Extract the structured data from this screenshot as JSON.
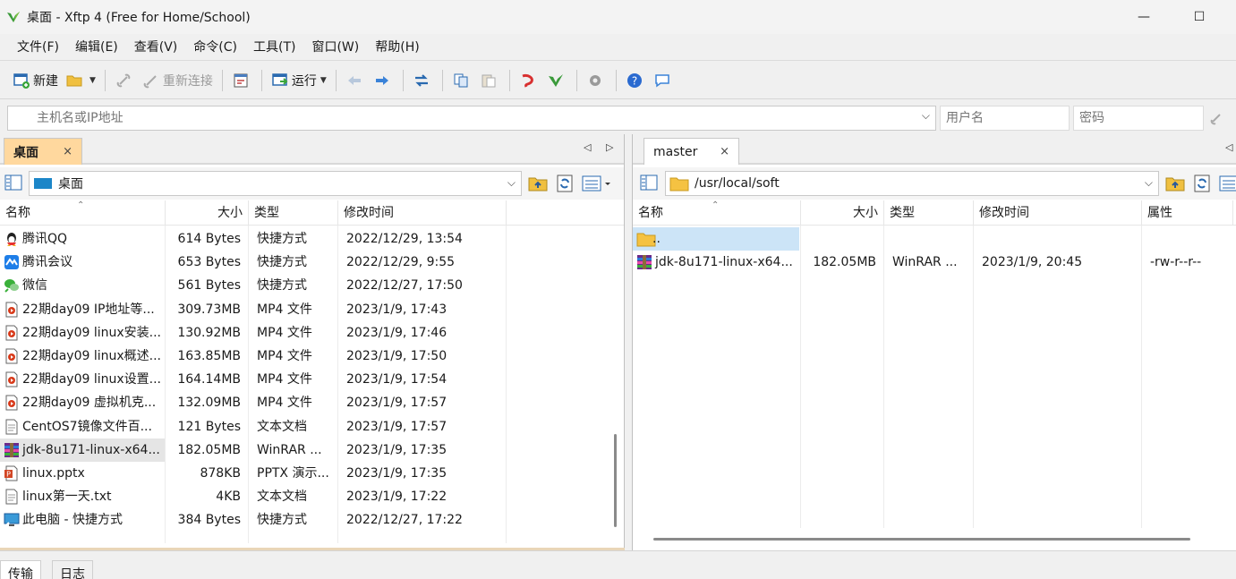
{
  "window": {
    "title": "桌面 - Xftp 4 (Free for Home/School)",
    "minimize": "—",
    "maximize": "☐",
    "close": "✕"
  },
  "menu": [
    "文件(F)",
    "编辑(E)",
    "查看(V)",
    "命令(C)",
    "工具(T)",
    "窗口(W)",
    "帮助(H)"
  ],
  "toolbar": {
    "new_label": "新建",
    "reconnect_label": "重新连接",
    "run_label": "运行"
  },
  "address": {
    "host_placeholder": "主机名或IP地址",
    "user_placeholder": "用户名",
    "pass_placeholder": "密码"
  },
  "left_panel": {
    "tab_label": "桌面",
    "tab_close": "×",
    "path": "桌面",
    "columns": [
      "名称",
      "大小",
      "类型",
      "修改时间"
    ],
    "files": [
      {
        "name": "腾讯QQ",
        "size": "614 Bytes",
        "type": "快捷方式",
        "modified": "2022/12/29, 13:54",
        "icon": "qq-icon"
      },
      {
        "name": "腾讯会议",
        "size": "653 Bytes",
        "type": "快捷方式",
        "modified": "2022/12/29, 9:55",
        "icon": "meeting-icon"
      },
      {
        "name": "微信",
        "size": "561 Bytes",
        "type": "快捷方式",
        "modified": "2022/12/27, 17:50",
        "icon": "wechat-icon"
      },
      {
        "name": "22期day09 IP地址等...",
        "size": "309.73MB",
        "type": "MP4 文件",
        "modified": "2023/1/9, 17:43",
        "icon": "video-file-icon"
      },
      {
        "name": "22期day09 linux安装...",
        "size": "130.92MB",
        "type": "MP4 文件",
        "modified": "2023/1/9, 17:46",
        "icon": "video-file-icon"
      },
      {
        "name": "22期day09 linux概述...",
        "size": "163.85MB",
        "type": "MP4 文件",
        "modified": "2023/1/9, 17:50",
        "icon": "video-file-icon"
      },
      {
        "name": "22期day09 linux设置...",
        "size": "164.14MB",
        "type": "MP4 文件",
        "modified": "2023/1/9, 17:54",
        "icon": "video-file-icon"
      },
      {
        "name": "22期day09 虚拟机克...",
        "size": "132.09MB",
        "type": "MP4 文件",
        "modified": "2023/1/9, 17:57",
        "icon": "video-file-icon"
      },
      {
        "name": "CentOS7镜像文件百...",
        "size": "121 Bytes",
        "type": "文本文档",
        "modified": "2023/1/9, 17:57",
        "icon": "text-file-icon"
      },
      {
        "name": "jdk-8u171-linux-x64...",
        "size": "182.05MB",
        "type": "WinRAR ...",
        "modified": "2023/1/9, 17:35",
        "icon": "winrar-icon"
      },
      {
        "name": "linux.pptx",
        "size": "878KB",
        "type": "PPTX 演示...",
        "modified": "2023/1/9, 17:35",
        "icon": "pptx-icon"
      },
      {
        "name": "linux第一天.txt",
        "size": "4KB",
        "type": "文本文档",
        "modified": "2023/1/9, 17:22",
        "icon": "text-file-icon"
      },
      {
        "name": "此电脑 - 快捷方式",
        "size": "384 Bytes",
        "type": "快捷方式",
        "modified": "2022/12/27, 17:22",
        "icon": "computer-shortcut-icon"
      }
    ]
  },
  "right_panel": {
    "tab_label": "master",
    "tab_close": "×",
    "path": "/usr/local/soft",
    "columns": [
      "名称",
      "大小",
      "类型",
      "修改时间",
      "属性"
    ],
    "files": [
      {
        "name": "..",
        "size": "",
        "type": "",
        "modified": "",
        "attr": "",
        "icon": "parent-folder-icon"
      },
      {
        "name": "jdk-8u171-linux-x64...",
        "size": "182.05MB",
        "type": "WinRAR ...",
        "modified": "2023/1/9, 20:45",
        "attr": "-rw-r--r--",
        "icon": "winrar-icon"
      }
    ]
  },
  "bottom_tabs": [
    "传输",
    "日志"
  ]
}
